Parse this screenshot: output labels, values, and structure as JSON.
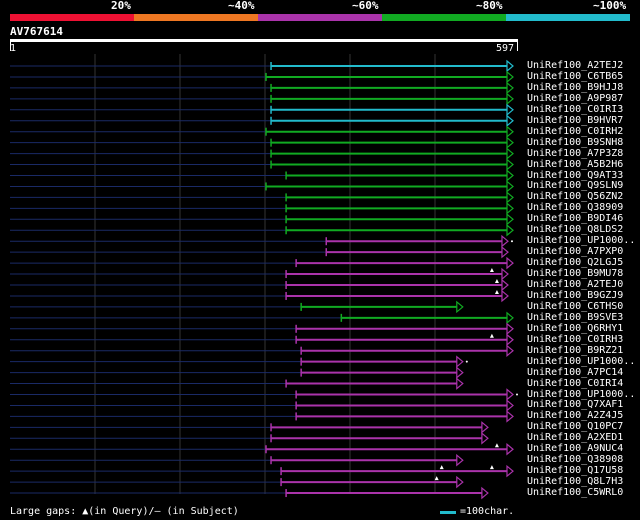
{
  "query": {
    "name": "AV767614",
    "start": "1",
    "end": "597"
  },
  "legend": {
    "labels": [
      "20%",
      "~40%",
      "~60%",
      "~80%",
      "~100%"
    ],
    "colors": [
      "#ee1133",
      "#ee7722",
      "#aa33aa",
      "#11aa22",
      "#22bbcc"
    ]
  },
  "footer": {
    "gaps": "Large gaps: ▲(in Query)/– (in Subject)",
    "scale": "=100char.",
    "scale_color": "#22bbcc"
  },
  "hits": [
    {
      "name": "UniRef100_A2TEJ2",
      "start": 0.52,
      "end": 1.0,
      "color": "cyan",
      "gaps": [],
      "head": "arrow"
    },
    {
      "name": "UniRef100_C6TB65",
      "start": 0.51,
      "end": 1.0,
      "color": "green",
      "gaps": [],
      "head": "arrow"
    },
    {
      "name": "UniRef100_B9HJJ8",
      "start": 0.52,
      "end": 1.0,
      "color": "green",
      "gaps": [],
      "head": "arrow"
    },
    {
      "name": "UniRef100_A9P987",
      "start": 0.52,
      "end": 1.0,
      "color": "green",
      "gaps": [],
      "head": "arrow"
    },
    {
      "name": "UniRef100_C0IRI3",
      "start": 0.52,
      "end": 1.0,
      "color": "cyan",
      "gaps": [],
      "head": "arrow"
    },
    {
      "name": "UniRef100_B9HVR7",
      "start": 0.52,
      "end": 1.0,
      "color": "cyan",
      "gaps": [],
      "head": "arrow"
    },
    {
      "name": "UniRef100_C0IRH2",
      "start": 0.51,
      "end": 1.0,
      "color": "green",
      "gaps": [],
      "head": "arrow"
    },
    {
      "name": "UniRef100_B9SNH8",
      "start": 0.52,
      "end": 1.0,
      "color": "green",
      "gaps": [],
      "head": "arrow"
    },
    {
      "name": "UniRef100_A7P3Z8",
      "start": 0.52,
      "end": 1.0,
      "color": "green",
      "gaps": [],
      "head": "arrow"
    },
    {
      "name": "UniRef100_A5B2H6",
      "start": 0.52,
      "end": 1.0,
      "color": "green",
      "gaps": [],
      "head": "arrow"
    },
    {
      "name": "UniRef100_Q9AT33",
      "start": 0.55,
      "end": 1.0,
      "color": "green",
      "gaps": [],
      "head": "arrow"
    },
    {
      "name": "UniRef100_Q9SLN9",
      "start": 0.51,
      "end": 1.0,
      "color": "green",
      "gaps": [],
      "head": "arrow"
    },
    {
      "name": "UniRef100_Q56ZN2",
      "start": 0.55,
      "end": 1.0,
      "color": "green",
      "gaps": [],
      "head": "arrow"
    },
    {
      "name": "UniRef100_Q38909",
      "start": 0.55,
      "end": 1.0,
      "color": "green",
      "gaps": [],
      "head": "arrow"
    },
    {
      "name": "UniRef100_B9DI46",
      "start": 0.55,
      "end": 1.0,
      "color": "green",
      "gaps": [],
      "head": "arrow"
    },
    {
      "name": "UniRef100_Q8LDS2",
      "start": 0.55,
      "end": 1.0,
      "color": "green",
      "gaps": [],
      "head": "arrow"
    },
    {
      "name": "UniRef100_UP1000..",
      "start": 0.63,
      "end": 0.99,
      "color": "purple",
      "gaps": [],
      "head": "arrow2"
    },
    {
      "name": "UniRef100_A7PXP0",
      "start": 0.63,
      "end": 0.99,
      "color": "purple",
      "gaps": [],
      "head": "arrow"
    },
    {
      "name": "UniRef100_Q2LGJ5",
      "start": 0.57,
      "end": 1.0,
      "color": "purple",
      "gaps": [],
      "head": "arrow"
    },
    {
      "name": "UniRef100_B9MU78",
      "start": 0.55,
      "end": 0.99,
      "color": "purple",
      "gaps": [
        0.96
      ],
      "head": "arrow"
    },
    {
      "name": "UniRef100_A2TEJ0",
      "start": 0.55,
      "end": 0.99,
      "color": "purple",
      "gaps": [
        0.97
      ],
      "head": "arrow"
    },
    {
      "name": "UniRef100_B9GZJ9",
      "start": 0.55,
      "end": 0.99,
      "color": "purple",
      "gaps": [
        0.97
      ],
      "head": "arrow"
    },
    {
      "name": "UniRef100_C6THS0",
      "start": 0.58,
      "end": 0.9,
      "color": "green",
      "gaps": [],
      "head": "arrow"
    },
    {
      "name": "UniRef100_B9SVE3",
      "start": 0.66,
      "end": 1.0,
      "color": "green",
      "gaps": [],
      "head": "arrow"
    },
    {
      "name": "UniRef100_Q6RHY1",
      "start": 0.57,
      "end": 1.0,
      "color": "purple",
      "gaps": [],
      "head": "arrow"
    },
    {
      "name": "UniRef100_C0IRH3",
      "start": 0.57,
      "end": 1.0,
      "color": "purple",
      "gaps": [
        0.96
      ],
      "head": "arrow"
    },
    {
      "name": "UniRef100_B9RZ21",
      "start": 0.58,
      "end": 1.0,
      "color": "purple",
      "gaps": [],
      "head": "arrow"
    },
    {
      "name": "UniRef100_UP1000..",
      "start": 0.58,
      "end": 0.9,
      "color": "purple",
      "gaps": [],
      "head": "arrow2"
    },
    {
      "name": "UniRef100_A7PC14",
      "start": 0.58,
      "end": 0.9,
      "color": "purple",
      "gaps": [],
      "head": "arrow"
    },
    {
      "name": "UniRef100_C0IRI4",
      "start": 0.55,
      "end": 0.9,
      "color": "purple",
      "gaps": [],
      "head": "arrow"
    },
    {
      "name": "UniRef100_UP1000..",
      "start": 0.57,
      "end": 1.0,
      "color": "purple",
      "gaps": [],
      "head": "arrow2"
    },
    {
      "name": "UniRef100_Q7XAF1",
      "start": 0.57,
      "end": 1.0,
      "color": "purple",
      "gaps": [],
      "head": "arrow"
    },
    {
      "name": "UniRef100_A2Z4J5",
      "start": 0.57,
      "end": 1.0,
      "color": "purple",
      "gaps": [],
      "head": "arrow"
    },
    {
      "name": "UniRef100_Q10PC7",
      "start": 0.52,
      "end": 0.95,
      "color": "purple",
      "gaps": [],
      "head": "arrow"
    },
    {
      "name": "UniRef100_A2XED1",
      "start": 0.52,
      "end": 0.95,
      "color": "purple",
      "gaps": [],
      "head": "arrow"
    },
    {
      "name": "UniRef100_A9NUC4",
      "start": 0.51,
      "end": 1.0,
      "color": "purple",
      "gaps": [
        0.97
      ],
      "head": "arrow"
    },
    {
      "name": "UniRef100_Q38908",
      "start": 0.52,
      "end": 0.9,
      "color": "purple",
      "gaps": [],
      "head": "arrow"
    },
    {
      "name": "UniRef100_Q17U58",
      "start": 0.54,
      "end": 1.0,
      "color": "purple",
      "gaps": [
        0.86,
        0.96
      ],
      "head": "arrow"
    },
    {
      "name": "UniRef100_Q8L7H3",
      "start": 0.54,
      "end": 0.9,
      "color": "purple",
      "gaps": [
        0.85
      ],
      "head": "arrow"
    },
    {
      "name": "UniRef100_C5WRL0",
      "start": 0.55,
      "end": 0.95,
      "color": "purple",
      "gaps": [],
      "head": "arrow"
    }
  ]
}
